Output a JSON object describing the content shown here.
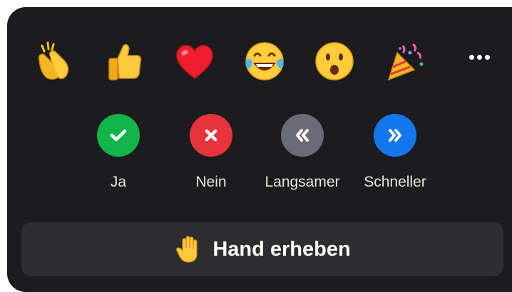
{
  "reactions": [
    {
      "name": "clapping-hands"
    },
    {
      "name": "thumbs-up"
    },
    {
      "name": "heart"
    },
    {
      "name": "tears-of-joy"
    },
    {
      "name": "open-mouth"
    },
    {
      "name": "party-popper"
    }
  ],
  "more": {
    "icon": "ellipsis-icon"
  },
  "feedback": [
    {
      "label": "Ja",
      "color": "#12b54a",
      "icon": "checkmark-icon"
    },
    {
      "label": "Nein",
      "color": "#e8333c",
      "icon": "x-icon"
    },
    {
      "label": "Langsamer",
      "color": "#6b6b78",
      "icon": "double-chevron-left-icon"
    },
    {
      "label": "Schneller",
      "color": "#1377f0",
      "icon": "double-chevron-right-icon"
    }
  ],
  "raise_hand": {
    "label": "Hand erheben",
    "icon": "raised-hand-icon"
  }
}
